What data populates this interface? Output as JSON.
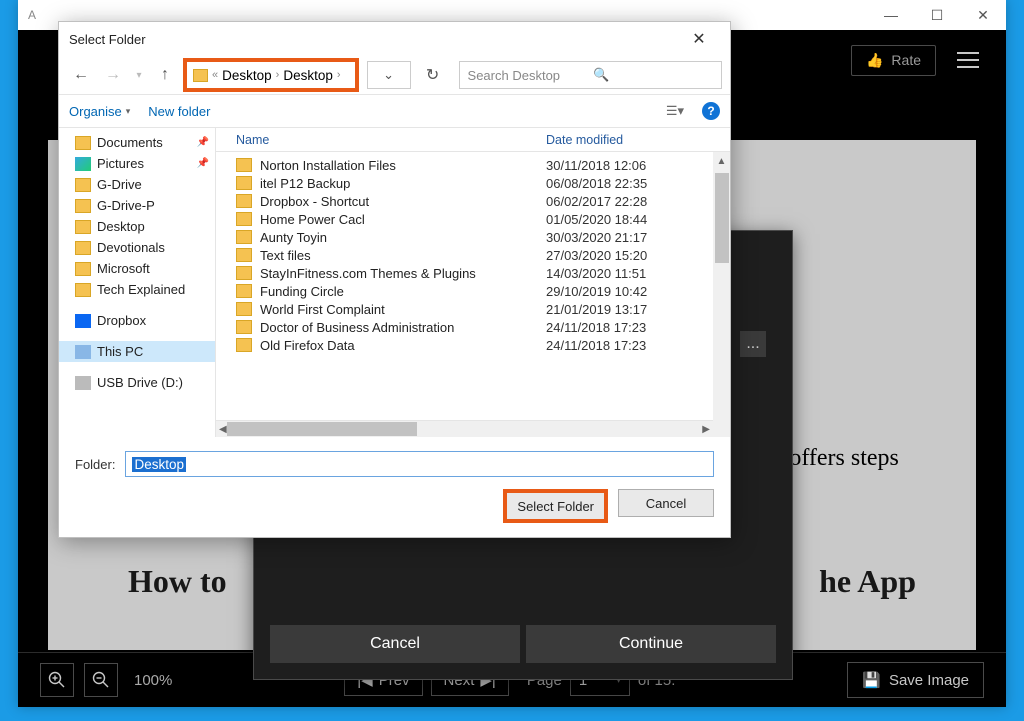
{
  "outer_app": {
    "title_prefix": "A",
    "win_buttons": {
      "min": "—",
      "max": "☐",
      "close": "✕"
    },
    "rate_label": "Rate",
    "doc_right_text": "is guide offers steps\n\nt.",
    "doc_heading_left": "How to",
    "doc_heading_right": "he App",
    "inner_dialog": {
      "cancel": "Cancel",
      "continue": "Continue",
      "dots": "..."
    },
    "bottom": {
      "zoom_label": "100%",
      "prev": "Prev",
      "next": "Next",
      "page_label": "Page",
      "page_value": "1",
      "of_label": "of 15.",
      "save_image": "Save Image"
    }
  },
  "win_dialog": {
    "title": "Select Folder",
    "breadcrumb": {
      "lead": "«",
      "seg1": "Desktop",
      "seg2": "Desktop"
    },
    "search_placeholder": "Search Desktop",
    "toolbar": {
      "organise": "Organise",
      "new_folder": "New folder"
    },
    "columns": {
      "name": "Name",
      "date": "Date modified"
    },
    "sidebar": [
      {
        "label": "Documents",
        "pin": true,
        "icon": "docs"
      },
      {
        "label": "Pictures",
        "pin": true,
        "icon": "pics"
      },
      {
        "label": "G-Drive",
        "icon": "folder"
      },
      {
        "label": "G-Drive-P",
        "icon": "folder"
      },
      {
        "label": "Desktop",
        "icon": "folder"
      },
      {
        "label": "Devotionals",
        "icon": "folder"
      },
      {
        "label": "Microsoft",
        "icon": "folder"
      },
      {
        "label": "Tech Explained",
        "icon": "folder"
      },
      {
        "label": "Dropbox",
        "icon": "dropbox",
        "gap": true
      },
      {
        "label": "This PC",
        "icon": "thispc",
        "selected": true,
        "gap": true
      },
      {
        "label": "USB Drive (D:)",
        "icon": "svg-usb",
        "gap": true
      }
    ],
    "files": [
      {
        "name": "Norton Installation Files",
        "date": "30/11/2018 12:06"
      },
      {
        "name": "itel P12 Backup",
        "date": "06/08/2018 22:35"
      },
      {
        "name": "Dropbox - Shortcut",
        "date": "06/02/2017 22:28"
      },
      {
        "name": "Home Power Cacl",
        "date": "01/05/2020 18:44"
      },
      {
        "name": "Aunty Toyin",
        "date": "30/03/2020 21:17"
      },
      {
        "name": "Text files",
        "date": "27/03/2020 15:20"
      },
      {
        "name": "StayInFitness.com Themes & Plugins",
        "date": "14/03/2020 11:51"
      },
      {
        "name": "Funding Circle",
        "date": "29/10/2019 10:42"
      },
      {
        "name": "World First Complaint",
        "date": "21/01/2019 13:17"
      },
      {
        "name": "Doctor of Business Administration",
        "date": "24/11/2018 17:23"
      },
      {
        "name": "Old Firefox Data",
        "date": "24/11/2018 17:23"
      }
    ],
    "folder_label": "Folder:",
    "folder_value": "Desktop",
    "buttons": {
      "select": "Select Folder",
      "cancel": "Cancel"
    }
  }
}
